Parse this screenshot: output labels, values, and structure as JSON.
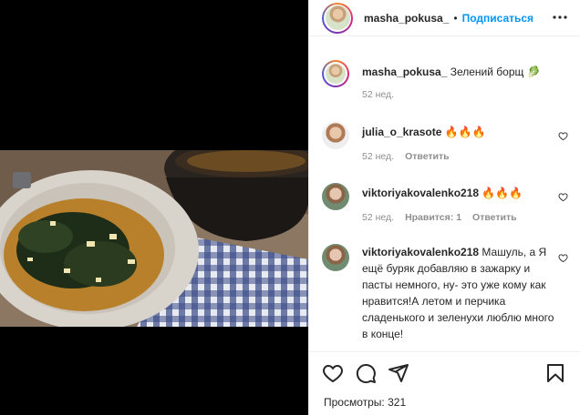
{
  "post": {
    "author": "masha_pokusa_",
    "separator": "•",
    "follow_label": "Подписаться"
  },
  "caption": {
    "author": "masha_pokusa_",
    "text": "Зелений борщ 🥬",
    "time": "52 нед."
  },
  "comments": [
    {
      "author": "julia_o_krasote",
      "text": "🔥🔥🔥",
      "time": "52 нед.",
      "likes": "",
      "reply_label": "Ответить"
    },
    {
      "author": "viktoriyakovalenko218",
      "text": "🔥🔥🔥",
      "time": "52 нед.",
      "likes": "Нравится: 1",
      "reply_label": "Ответить"
    },
    {
      "author": "viktoriyakovalenko218",
      "text": "Машуль, а Я ещё буряк добавляю в зажарку и пасты немного, ну- это уже кому как нравится!А летом и перчика сладенького и зеленухи люблю много в конце!",
      "time": "",
      "likes": "",
      "reply_label": ""
    }
  ],
  "footer": {
    "views_label": "Просмотры: 321"
  },
  "icons": {
    "more": "more-icon",
    "like": "heart-icon",
    "comment": "comment-icon",
    "share": "share-icon",
    "save": "bookmark-icon"
  }
}
